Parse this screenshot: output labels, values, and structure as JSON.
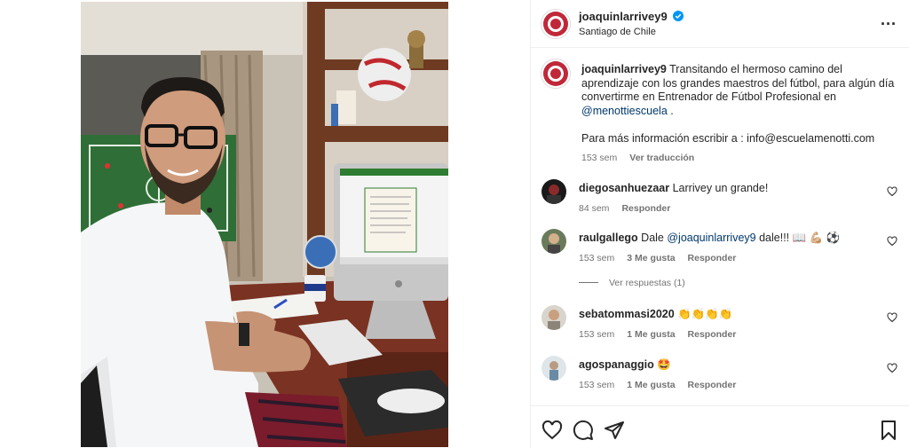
{
  "header": {
    "username": "joaquinlarrivey9",
    "location": "Santiago de Chile"
  },
  "caption": {
    "username": "joaquinlarrivey9",
    "text_before": "Transitando el hermoso camino del aprendizaje con los grandes maestros del fútbol, para algún día convertirme en Entrenador de Fútbol Profesional en ",
    "mention": "@menottiescuela",
    "text_after": " .",
    "info": "Para más información escribir a : info@escuelamenotti.com",
    "time": "153 sem",
    "translate": "Ver traducción"
  },
  "comments": [
    {
      "username": "diegosanhuezaar",
      "text": "Larrivey un grande!",
      "time": "84 sem",
      "likes": "",
      "reply": "Responder"
    },
    {
      "username": "raulgallego",
      "text_before": "Dale ",
      "mention": "@joaquinlarrivey9",
      "text_after": " dale!!! 📖 💪🏼 ⚽",
      "time": "153 sem",
      "likes": "3 Me gusta",
      "reply": "Responder"
    },
    {
      "username": "sebatommasi2020",
      "text": "👏👏👏👏",
      "time": "153 sem",
      "likes": "1 Me gusta",
      "reply": "Responder"
    },
    {
      "username": "agospanaggio",
      "text": "🤩",
      "time": "153 sem",
      "likes": "1 Me gusta",
      "reply": "Responder"
    }
  ],
  "view_replies": "Ver respuestas (1)",
  "icons": {
    "more": "more-options-icon",
    "like": "heart-icon",
    "comment": "comment-icon",
    "share": "share-icon",
    "save": "bookmark-icon"
  },
  "colors": {
    "verified": "#0095f6",
    "mention": "#00376b",
    "meta": "#737373",
    "text": "#262626"
  }
}
